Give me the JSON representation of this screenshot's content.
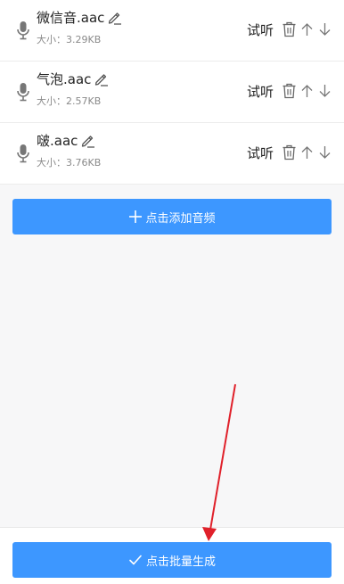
{
  "files": [
    {
      "name": "微信音.aac",
      "size": "大小：3.29KB",
      "listen_label": "试听"
    },
    {
      "name": "气泡.aac",
      "size": "大小：2.57KB",
      "listen_label": "试听"
    },
    {
      "name": "啵.aac",
      "size": "大小：3.76KB",
      "listen_label": "试听"
    }
  ],
  "add_button": {
    "label": "点击添加音频",
    "icon": "plus-icon"
  },
  "generate_button": {
    "label": "点击批量生成",
    "icon": "check-icon"
  },
  "colors": {
    "accent": "#3d97ff",
    "annotation_arrow": "#e0202a",
    "icon_gray": "#777777"
  }
}
